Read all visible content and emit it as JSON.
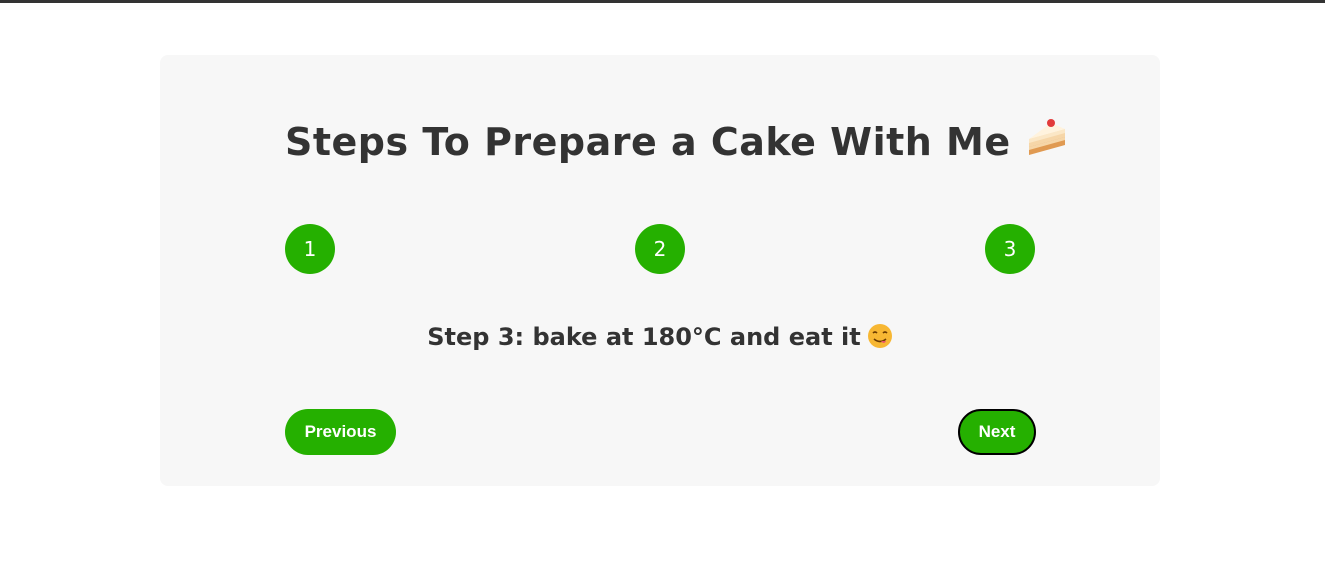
{
  "app": {
    "title": "Steps To Prepare a Cake With Me",
    "title_icon": "cake-slice-icon"
  },
  "steps": [
    "1",
    "2",
    "3"
  ],
  "current_step": 3,
  "message": {
    "text": "Step 3: bake at 180°C and eat it",
    "icon": "yum-face-icon"
  },
  "buttons": {
    "previous_label": "Previous",
    "next_label": "Next"
  },
  "colors": {
    "accent": "#25b000",
    "text": "#333333",
    "card_background": "#f7f7f7"
  }
}
